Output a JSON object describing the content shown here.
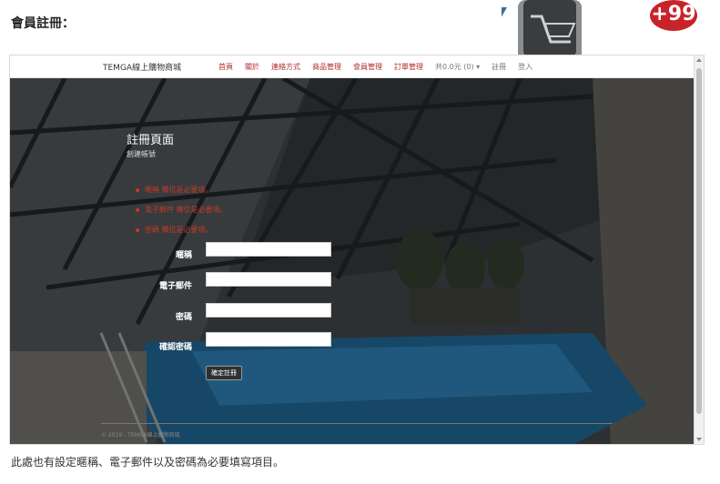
{
  "page": {
    "heading": "會員註冊：",
    "caption": "此處也有設定暱稱、電子郵件以及密碼為必要填寫項目。",
    "badge": "+99"
  },
  "site": {
    "brand": "TEMGA線上購物商城",
    "nav": {
      "home": "首頁",
      "about": "關於",
      "contact": "連絡方式",
      "products": "商品管理",
      "members": "會員管理",
      "orders": "訂單管理",
      "cart": "共0.0元 (0) ▾",
      "register": "註冊",
      "login": "登入"
    }
  },
  "form": {
    "title": "註冊頁面",
    "subtitle": "創建帳號",
    "errors": [
      "暱稱 欄位是必要項。",
      "電子郵件 欄位是必要項。",
      "密碼 欄位是必要項。"
    ],
    "fields": {
      "nickname": "暱稱",
      "email": "電子郵件",
      "password": "密碼",
      "confirm": "確認密碼"
    },
    "submit": "確定註冊"
  },
  "footer": {
    "text": "© 2019 - TEMGA線上購物商城"
  },
  "colors": {
    "nav_link": "#b02a2a",
    "error": "#c0392b",
    "badge": "#c9232a"
  }
}
